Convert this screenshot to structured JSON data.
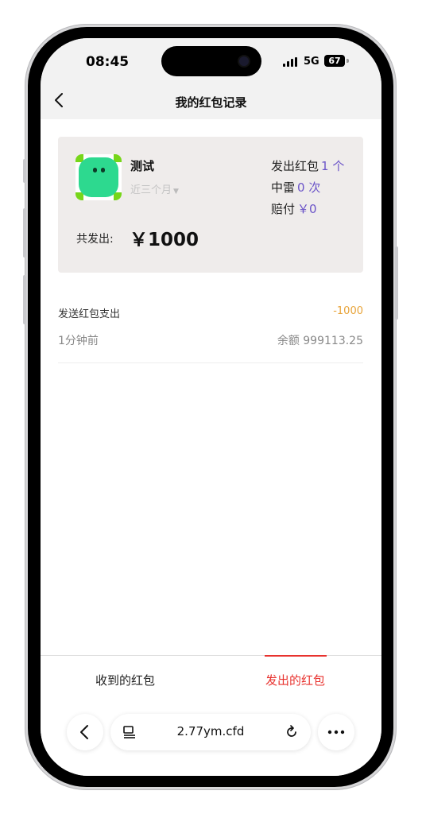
{
  "status_bar": {
    "time": "08:45",
    "network": "5G",
    "battery": "67"
  },
  "nav": {
    "title": "我的红包记录"
  },
  "summary": {
    "name": "测试",
    "period": "近三个月",
    "stats": [
      {
        "label": "发出红包",
        "value": "1 个"
      },
      {
        "label": "中雷",
        "value": "0 次"
      },
      {
        "label": "赔付",
        "value": "￥0"
      }
    ],
    "total_label": "共发出:",
    "total_value": "￥1000"
  },
  "records": [
    {
      "title": "发送红包支出",
      "amount": "-1000",
      "time": "1分钟前",
      "balance": "余额  999113.25"
    }
  ],
  "tabs": [
    {
      "label": "收到的红包",
      "active": false
    },
    {
      "label": "发出的红包",
      "active": true
    }
  ],
  "browser": {
    "url": "2.77ym.cfd"
  },
  "colors": {
    "accent_red": "#e8322e",
    "stat_value": "#6b54c8",
    "amount": "#e8a43a",
    "icon_green": "#2dd98f"
  }
}
